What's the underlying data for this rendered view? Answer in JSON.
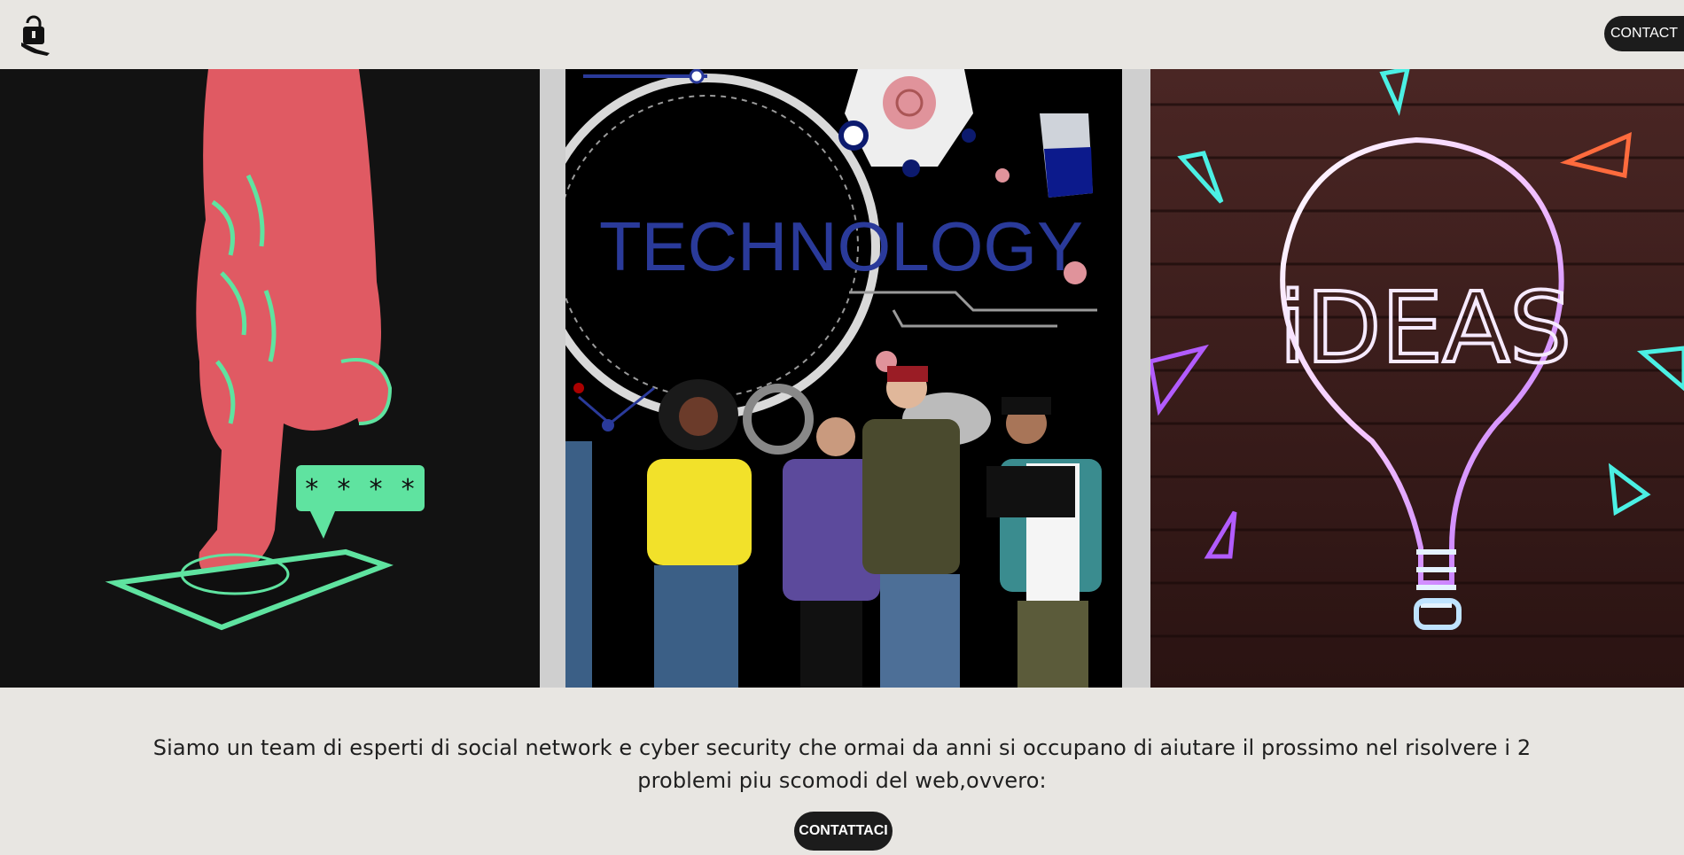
{
  "header": {
    "logo_icon": "lock-hand-icon",
    "contact_label": "CONTACT"
  },
  "gallery": {
    "panels": [
      {
        "name": "password-security-illustration",
        "badge_text": "* * * *"
      },
      {
        "name": "technology-people-photo",
        "title": "TECHNOLOGY"
      },
      {
        "name": "ideas-neon-bulb",
        "neon_text": "iDEAS"
      }
    ]
  },
  "intro": {
    "text": "Siamo un team di esperti di social network e cyber security che ormai da anni si occupano di aiutare il prossimo nel risolvere i 2 problemi piu scomodi del web,ovvero:"
  },
  "cta": {
    "label": "CONTATTACI"
  },
  "colors": {
    "background": "#e8e6e2",
    "button": "#1c1c1c",
    "accent_red": "#e05a63",
    "accent_green": "#5fe3a0",
    "tech_blue": "#2a3a9a"
  }
}
